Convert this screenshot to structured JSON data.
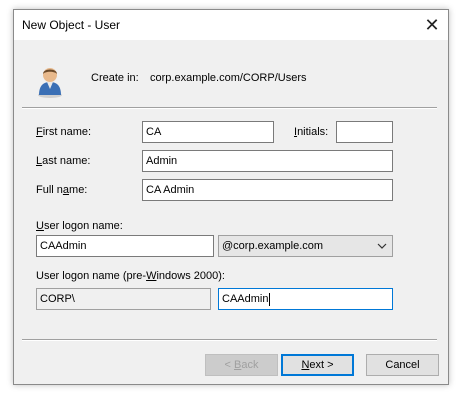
{
  "window": {
    "title": "New Object - User",
    "close_glyph": "✕"
  },
  "header": {
    "create_in_label": "Create in:",
    "create_in_path": "corp.example.com/CORP/Users",
    "icon": "user-icon"
  },
  "form": {
    "first_name": {
      "label_u": "F",
      "label_rest": "irst name:",
      "value": "CA"
    },
    "initials": {
      "label_u": "I",
      "label_rest": "nitials:",
      "value": ""
    },
    "last_name": {
      "label_u": "L",
      "label_rest": "ast name:",
      "value": "Admin"
    },
    "full_name": {
      "label_pre": "Full n",
      "label_u": "a",
      "label_rest": "me:",
      "value": "CA Admin"
    },
    "logon_name": {
      "label_u": "U",
      "label_rest": "ser logon name:",
      "value": "CAAdmin",
      "domain": "@corp.example.com"
    },
    "pre2000": {
      "label_pre": "User logon name (pre-",
      "label_u": "W",
      "label_rest": "indows 2000):",
      "domain": "CORP\\",
      "value": "CAAdmin"
    }
  },
  "buttons": {
    "back": {
      "pre": "< ",
      "u": "B",
      "rest": "ack"
    },
    "next": {
      "u": "N",
      "rest": "ext >"
    },
    "cancel": "Cancel"
  }
}
